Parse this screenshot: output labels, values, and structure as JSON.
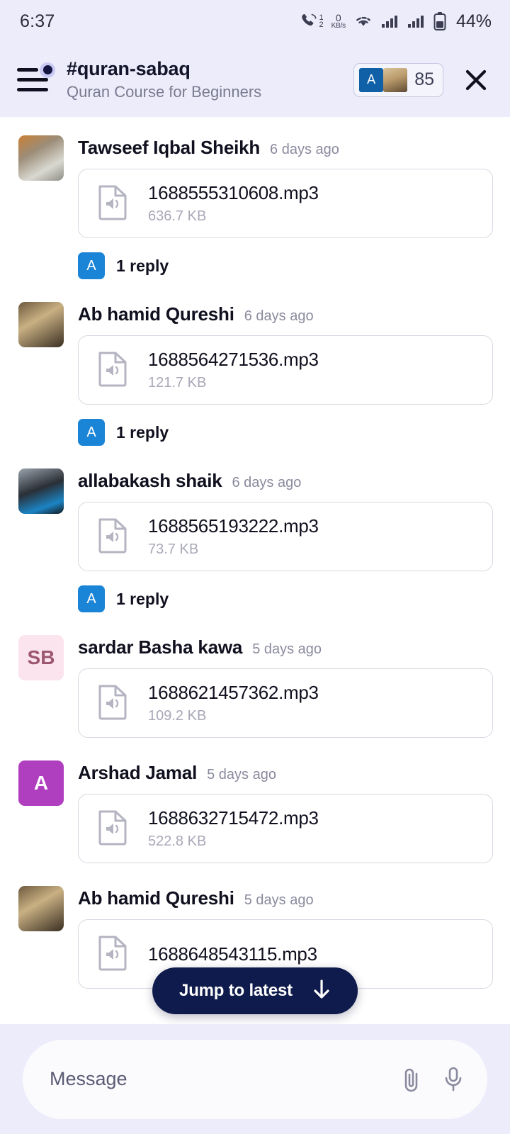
{
  "status_bar": {
    "time": "6:37",
    "call_badge_top": "1",
    "call_badge_bottom": "2",
    "net_speed_value": "0",
    "net_speed_unit": "KB/s",
    "battery": "44%"
  },
  "header": {
    "channel_name": "#quran-sabaq",
    "channel_subtitle": "Quran Course for Beginners",
    "member_count": "85",
    "member_avatar_initial": "A"
  },
  "colors": {
    "header_bg": "#ECECFB",
    "reply_badge": "#1A84D6",
    "jump_button": "#0F1B4C",
    "accent_dot": "#151544"
  },
  "messages": [
    {
      "author": "Tawseef Iqbal Sheikh",
      "time": "6 days ago",
      "avatar_type": "photo",
      "avatar_class": "photo-1",
      "avatar_initials": "",
      "file_name": "1688555310608.mp3",
      "file_size": "636.7 KB",
      "reply_count": "1 reply",
      "reply_avatar_initial": "A"
    },
    {
      "author": "Ab hamid Qureshi",
      "time": "6 days ago",
      "avatar_type": "photo",
      "avatar_class": "photo-2",
      "avatar_initials": "",
      "file_name": "1688564271536.mp3",
      "file_size": "121.7 KB",
      "reply_count": "1 reply",
      "reply_avatar_initial": "A"
    },
    {
      "author": "allabakash shaik",
      "time": "6 days ago",
      "avatar_type": "photo",
      "avatar_class": "photo-3",
      "avatar_initials": "",
      "file_name": "1688565193222.mp3",
      "file_size": "73.7 KB",
      "reply_count": "1 reply",
      "reply_avatar_initial": "A"
    },
    {
      "author": "sardar Basha kawa",
      "time": "5 days ago",
      "avatar_type": "initials",
      "avatar_bg": "#FBE4ED",
      "avatar_fg": "#9C5670",
      "avatar_initials": "SB",
      "file_name": "1688621457362.mp3",
      "file_size": "109.2 KB",
      "reply_count": "",
      "reply_avatar_initial": ""
    },
    {
      "author": "Arshad Jamal",
      "time": "5 days ago",
      "avatar_type": "initials",
      "avatar_bg": "#B03FC0",
      "avatar_fg": "#FFFFFF",
      "avatar_initials": "A",
      "file_name": "1688632715472.mp3",
      "file_size": "522.8 KB",
      "reply_count": "",
      "reply_avatar_initial": ""
    },
    {
      "author": "Ab hamid Qureshi",
      "time": "5 days ago",
      "avatar_type": "photo",
      "avatar_class": "photo-2",
      "avatar_initials": "",
      "file_name": "1688648543115.mp3",
      "file_size": "",
      "reply_count": "",
      "reply_avatar_initial": ""
    }
  ],
  "jump_to_latest": {
    "label": "Jump to latest"
  },
  "composer": {
    "placeholder": "Message",
    "value": ""
  }
}
